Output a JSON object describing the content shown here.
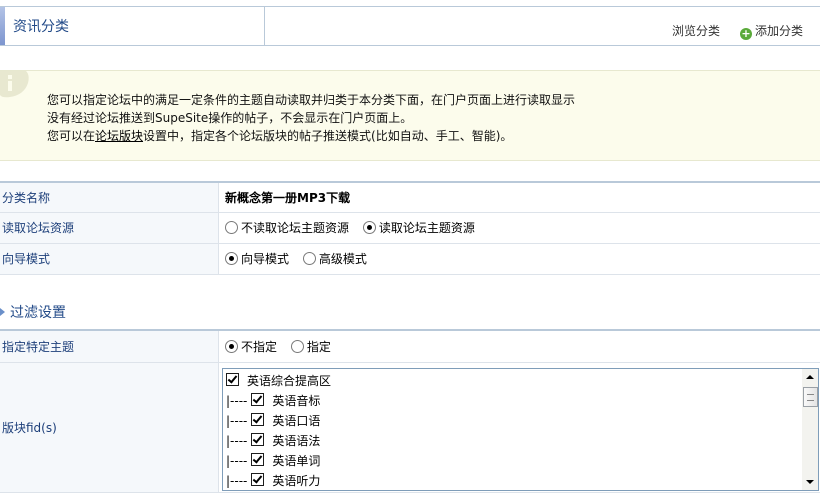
{
  "header": {
    "title": "资讯分类",
    "browse_label": "浏览分类",
    "add_label": "添加分类",
    "add_icon": "plus-circle-icon"
  },
  "info": {
    "icon": "info-icon",
    "line1": "您可以指定论坛中的满足一定条件的主题自动读取并归类于本分类下面，在门户页面上进行读取显示",
    "line2": "没有经过论坛推送到SupeSite操作的帖子，不会显示在门户页面上。",
    "line3_prefix": "您可以在",
    "line3_link": "论坛版块",
    "line3_suffix": "设置中，指定各个论坛版块的帖子推送模式(比如自动、手工、智能)。"
  },
  "form": {
    "category_name_label": "分类名称",
    "category_name_value": "新概念第一册MP3下载",
    "read_source_label": "读取论坛资源",
    "read_source_options": [
      "不读取论坛主题资源",
      "读取论坛主题资源"
    ],
    "read_source_selected": 1,
    "guide_mode_label": "向导模式",
    "guide_mode_options": [
      "向导模式",
      "高级模式"
    ],
    "guide_mode_selected": 0
  },
  "filter": {
    "section_title": "过滤设置",
    "specific_topic_label": "指定特定主题",
    "specific_topic_options": [
      "不指定",
      "指定"
    ],
    "specific_topic_selected": 0,
    "fid_label": "版块fid(s)",
    "fid_items": [
      {
        "prefix": "",
        "label": "英语综合提高区",
        "checked": true
      },
      {
        "prefix": "|----",
        "label": "英语音标",
        "checked": true
      },
      {
        "prefix": "|----",
        "label": "英语口语",
        "checked": true
      },
      {
        "prefix": "|----",
        "label": "英语语法",
        "checked": true
      },
      {
        "prefix": "|----",
        "label": "英语单词",
        "checked": true
      },
      {
        "prefix": "|----",
        "label": "英语听力",
        "checked": true
      }
    ]
  }
}
